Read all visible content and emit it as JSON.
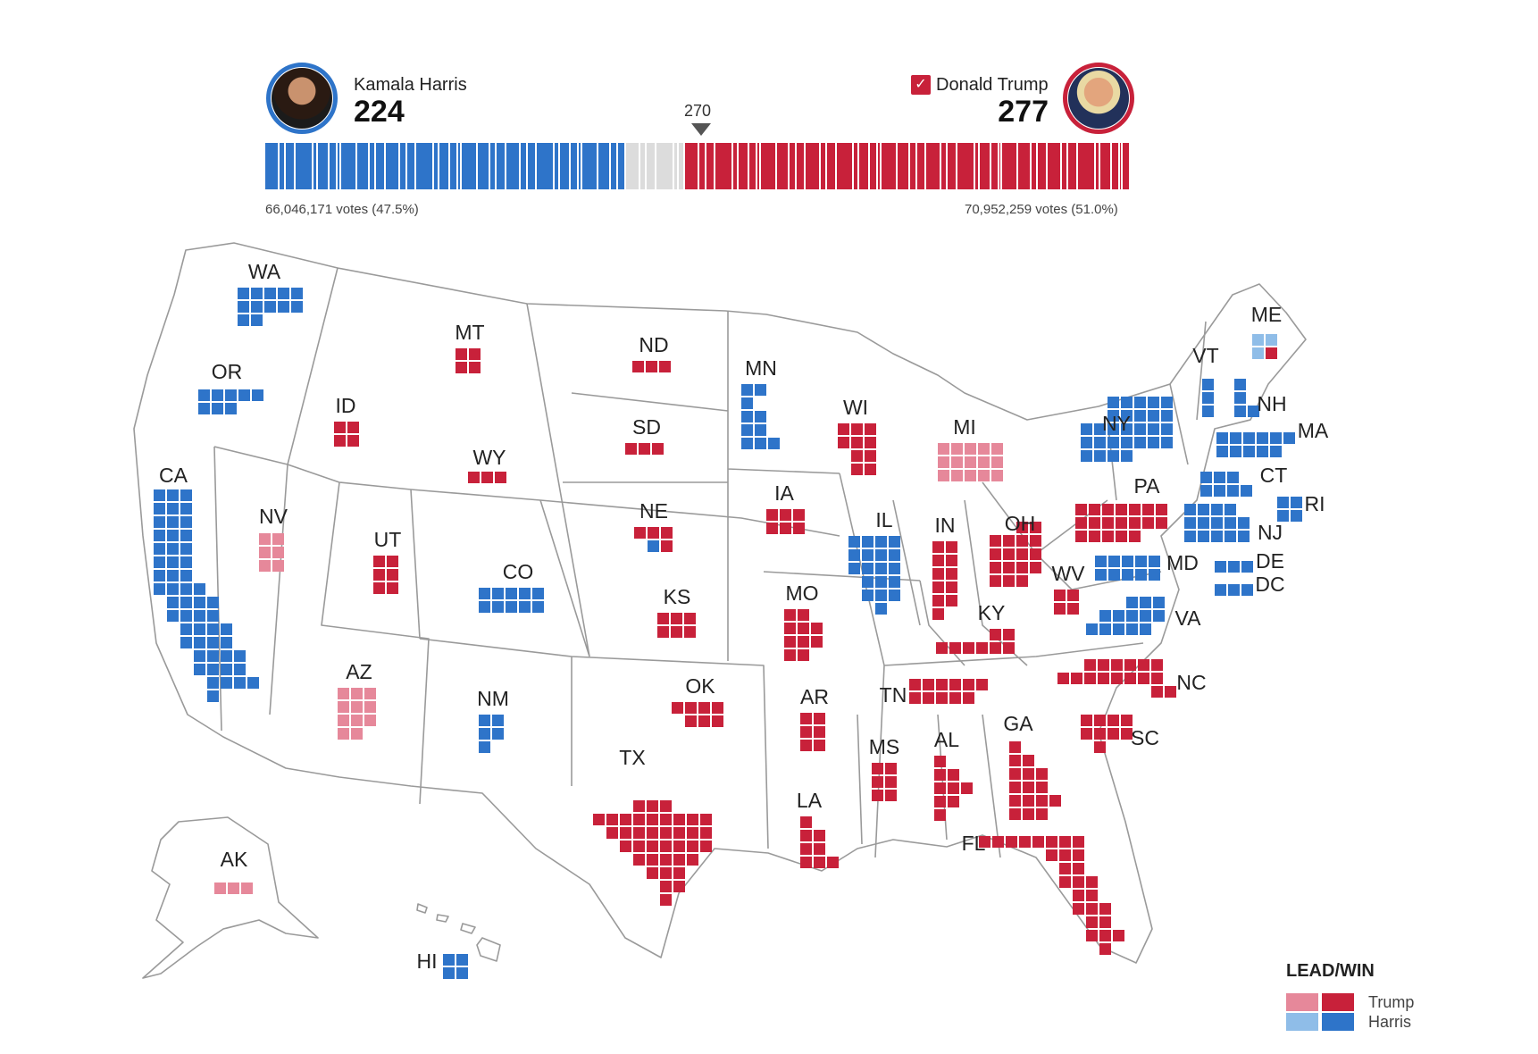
{
  "header": {
    "threshold_label": "270",
    "harris": {
      "name": "Kamala Harris",
      "electoral_votes": "224",
      "popular_vote": "66,046,171 votes (47.5%)"
    },
    "trump": {
      "name": "Donald Trump",
      "electoral_votes": "277",
      "popular_vote": "70,952,259 votes (51.0%)",
      "winner_check": "✓"
    },
    "bar": {
      "harris_ev": 224,
      "undecided_ev": 37,
      "trump_ev": 277,
      "total": 538
    }
  },
  "colors": {
    "trump_win": "#c8213a",
    "trump_lead": "#e6889a",
    "harris_win": "#2e74c9",
    "harris_lead": "#8fbde8",
    "undecided": "#dcdcdc",
    "border": "#9a9a9a"
  },
  "legend": {
    "title": "LEAD/WIN",
    "trump": "Trump",
    "harris": "Harris"
  },
  "states": [
    {
      "code": "WA",
      "status": "harris_win",
      "ev": 12
    },
    {
      "code": "OR",
      "status": "harris_win",
      "ev": 8
    },
    {
      "code": "CA",
      "status": "harris_win",
      "ev": 54
    },
    {
      "code": "NV",
      "status": "trump_lead",
      "ev": 6
    },
    {
      "code": "ID",
      "status": "trump_win",
      "ev": 4
    },
    {
      "code": "MT",
      "status": "trump_win",
      "ev": 4
    },
    {
      "code": "WY",
      "status": "trump_win",
      "ev": 3
    },
    {
      "code": "UT",
      "status": "trump_win",
      "ev": 6
    },
    {
      "code": "AZ",
      "status": "trump_lead",
      "ev": 11
    },
    {
      "code": "CO",
      "status": "harris_win",
      "ev": 10
    },
    {
      "code": "NM",
      "status": "harris_win",
      "ev": 5
    },
    {
      "code": "ND",
      "status": "trump_win",
      "ev": 3
    },
    {
      "code": "SD",
      "status": "trump_win",
      "ev": 3
    },
    {
      "code": "NE",
      "status": "trump_win",
      "ev": 5,
      "note": "4 Trump, 1 Harris"
    },
    {
      "code": "KS",
      "status": "trump_win",
      "ev": 6
    },
    {
      "code": "OK",
      "status": "trump_win",
      "ev": 7
    },
    {
      "code": "TX",
      "status": "trump_win",
      "ev": 40
    },
    {
      "code": "MN",
      "status": "harris_win",
      "ev": 10
    },
    {
      "code": "IA",
      "status": "trump_win",
      "ev": 6
    },
    {
      "code": "MO",
      "status": "trump_win",
      "ev": 10
    },
    {
      "code": "AR",
      "status": "trump_win",
      "ev": 6
    },
    {
      "code": "LA",
      "status": "trump_win",
      "ev": 8
    },
    {
      "code": "WI",
      "status": "trump_win",
      "ev": 10
    },
    {
      "code": "IL",
      "status": "harris_win",
      "ev": 19
    },
    {
      "code": "MI",
      "status": "trump_lead",
      "ev": 15
    },
    {
      "code": "IN",
      "status": "trump_win",
      "ev": 11
    },
    {
      "code": "OH",
      "status": "trump_win",
      "ev": 17
    },
    {
      "code": "KY",
      "status": "trump_win",
      "ev": 8
    },
    {
      "code": "TN",
      "status": "trump_win",
      "ev": 11
    },
    {
      "code": "MS",
      "status": "trump_win",
      "ev": 6
    },
    {
      "code": "AL",
      "status": "trump_win",
      "ev": 9
    },
    {
      "code": "GA",
      "status": "trump_win",
      "ev": 16
    },
    {
      "code": "FL",
      "status": "trump_win",
      "ev": 30
    },
    {
      "code": "SC",
      "status": "trump_win",
      "ev": 9
    },
    {
      "code": "NC",
      "status": "trump_win",
      "ev": 16
    },
    {
      "code": "VA",
      "status": "harris_win",
      "ev": 13
    },
    {
      "code": "WV",
      "status": "trump_win",
      "ev": 4
    },
    {
      "code": "PA",
      "status": "trump_win",
      "ev": 19
    },
    {
      "code": "NY",
      "status": "harris_win",
      "ev": 28
    },
    {
      "code": "VT",
      "status": "harris_win",
      "ev": 3
    },
    {
      "code": "NH",
      "status": "harris_win",
      "ev": 4
    },
    {
      "code": "ME",
      "status": "harris_lead",
      "ev": 4,
      "note": "2 Harris lead, 1 Harris lead, 1 Trump win"
    },
    {
      "code": "MA",
      "status": "harris_win",
      "ev": 11
    },
    {
      "code": "CT",
      "status": "harris_win",
      "ev": 7
    },
    {
      "code": "RI",
      "status": "harris_win",
      "ev": 4
    },
    {
      "code": "NJ",
      "status": "harris_win",
      "ev": 14
    },
    {
      "code": "DE",
      "status": "harris_win",
      "ev": 3
    },
    {
      "code": "MD",
      "status": "harris_win",
      "ev": 10
    },
    {
      "code": "DC",
      "status": "harris_win",
      "ev": 3
    },
    {
      "code": "AK",
      "status": "trump_lead",
      "ev": 3
    },
    {
      "code": "HI",
      "status": "harris_win",
      "ev": 4
    }
  ]
}
